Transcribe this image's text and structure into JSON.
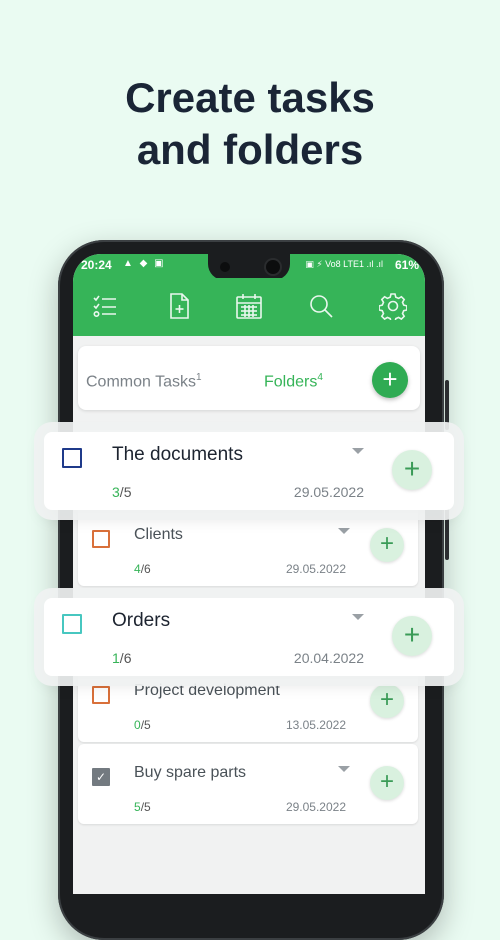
{
  "headline": {
    "line1": "Create tasks",
    "line2": "and folders"
  },
  "statusbar": {
    "time": "20:24",
    "left_icons": "▲ ◆ ▣",
    "right_icons": "▣ ⚡ Vo8 LTE1 .ıl .ıl",
    "battery": "61%"
  },
  "toolbar": {
    "icons": [
      "task-list-icon",
      "new-file-icon",
      "calendar-icon",
      "search-icon",
      "gear-icon"
    ]
  },
  "tabs": {
    "common_label": "Common Tasks",
    "common_count": "1",
    "folders_label": "Folders",
    "folders_count": "4",
    "add": "+"
  },
  "folders": [
    {
      "title": "The documents",
      "done": "3",
      "total": "5",
      "date": "29.05.2022",
      "color": "#1f3a8a",
      "checked": false
    },
    {
      "title": "Clients",
      "done": "4",
      "total": "6",
      "date": "29.05.2022",
      "color": "#d9703a",
      "checked": false
    },
    {
      "title": "Orders",
      "done": "1",
      "total": "6",
      "date": "20.04.2022",
      "color": "#47c7c0",
      "checked": false
    },
    {
      "title": "Project development",
      "done": "0",
      "total": "5",
      "date": "13.05.2022",
      "color": "#d9703a",
      "checked": false
    },
    {
      "title": "Buy spare parts",
      "done": "5",
      "total": "5",
      "date": "29.05.2022",
      "color": "#737a80",
      "checked": true
    }
  ],
  "plus": "+",
  "slash": "/",
  "checkmark": "✓"
}
